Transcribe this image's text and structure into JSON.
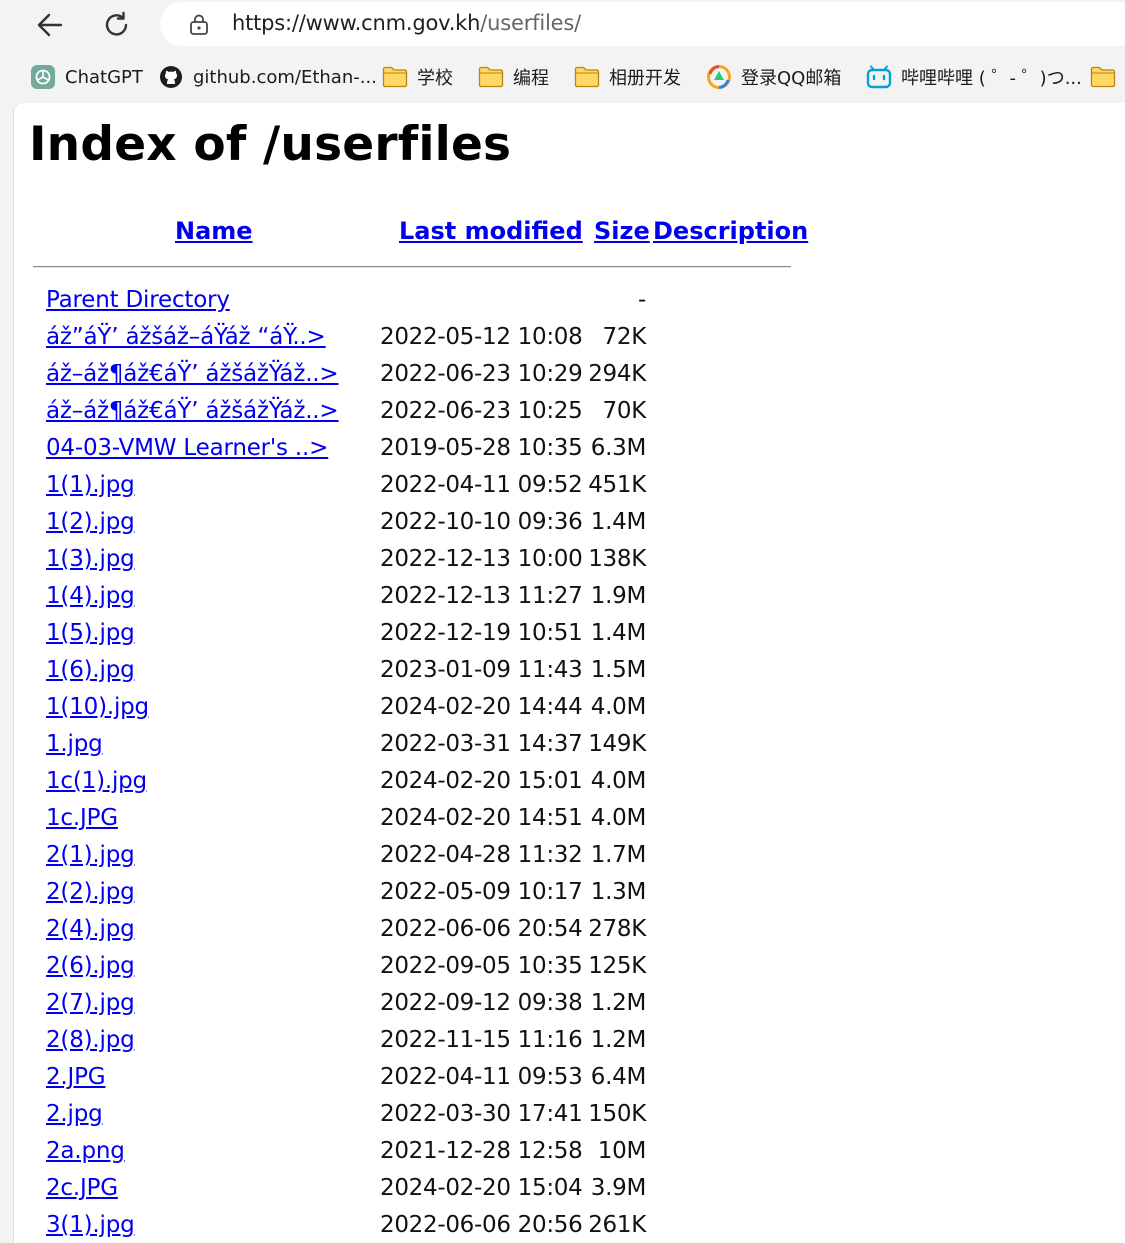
{
  "browser": {
    "url_main": "https://www.cnm.gov.kh",
    "url_path": "/userfiles/",
    "bookmarks": [
      {
        "label": "ChatGPT",
        "icon": "chatgpt-icon"
      },
      {
        "label": "github.com/Ethan-...",
        "icon": "github-icon"
      },
      {
        "label": "学校",
        "icon": "folder-icon"
      },
      {
        "label": "编程",
        "icon": "folder-icon"
      },
      {
        "label": "相册开发",
        "icon": "folder-icon"
      },
      {
        "label": "登录QQ邮箱",
        "icon": "qq-mail-icon"
      },
      {
        "label": "哔哩哔哩 ( ゜- ゜)つ...",
        "icon": "bilibili-icon"
      },
      {
        "label": "",
        "icon": "folder-icon"
      }
    ]
  },
  "page": {
    "title": "Index of /userfiles",
    "columns": {
      "name": "Name",
      "modified": "Last modified",
      "size": "Size",
      "description": "Description"
    },
    "rows": [
      {
        "name": "Parent Directory",
        "date": "",
        "size": "-"
      },
      {
        "name": "áž”áŸ’ ážšáž–áŸáž “áŸ..>",
        "date": "2022-05-12 10:08",
        "size": "72K"
      },
      {
        "name": "áž–áž¶áž€áŸ’ ážšážŸáž..>",
        "date": "2022-06-23 10:29",
        "size": "294K"
      },
      {
        "name": "áž–áž¶áž€áŸ’ ážšážŸáž..>",
        "date": "2022-06-23 10:25",
        "size": "70K"
      },
      {
        "name": "04-03-VMW Learner's ..>",
        "date": "2019-05-28 10:35",
        "size": "6.3M"
      },
      {
        "name": "1(1).jpg",
        "date": "2022-04-11 09:52",
        "size": "451K"
      },
      {
        "name": "1(2).jpg",
        "date": "2022-10-10 09:36",
        "size": "1.4M"
      },
      {
        "name": "1(3).jpg",
        "date": "2022-12-13 10:00",
        "size": "138K"
      },
      {
        "name": "1(4).jpg",
        "date": "2022-12-13 11:27",
        "size": "1.9M"
      },
      {
        "name": "1(5).jpg",
        "date": "2022-12-19 10:51",
        "size": "1.4M"
      },
      {
        "name": "1(6).jpg",
        "date": "2023-01-09 11:43",
        "size": "1.5M"
      },
      {
        "name": "1(10).jpg",
        "date": "2024-02-20 14:44",
        "size": "4.0M"
      },
      {
        "name": "1.jpg",
        "date": "2022-03-31 14:37",
        "size": "149K"
      },
      {
        "name": "1c(1).jpg",
        "date": "2024-02-20 15:01",
        "size": "4.0M"
      },
      {
        "name": "1c.JPG",
        "date": "2024-02-20 14:51",
        "size": "4.0M"
      },
      {
        "name": "2(1).jpg",
        "date": "2022-04-28 11:32",
        "size": "1.7M"
      },
      {
        "name": "2(2).jpg",
        "date": "2022-05-09 10:17",
        "size": "1.3M"
      },
      {
        "name": "2(4).jpg",
        "date": "2022-06-06 20:54",
        "size": "278K"
      },
      {
        "name": "2(6).jpg",
        "date": "2022-09-05 10:35",
        "size": "125K"
      },
      {
        "name": "2(7).jpg",
        "date": "2022-09-12 09:38",
        "size": "1.2M"
      },
      {
        "name": "2(8).jpg",
        "date": "2022-11-15 11:16",
        "size": "1.2M"
      },
      {
        "name": "2.JPG",
        "date": "2022-04-11 09:53",
        "size": "6.4M"
      },
      {
        "name": "2.jpg",
        "date": "2022-03-30 17:41",
        "size": "150K"
      },
      {
        "name": "2a.png",
        "date": "2021-12-28 12:58",
        "size": "10M"
      },
      {
        "name": "2c.JPG",
        "date": "2024-02-20 15:04",
        "size": "3.9M"
      },
      {
        "name": "3(1).jpg",
        "date": "2022-06-06 20:56",
        "size": "261K"
      }
    ]
  },
  "colors": {
    "link": "#0000ee",
    "chrome": "#f3f3f3"
  }
}
